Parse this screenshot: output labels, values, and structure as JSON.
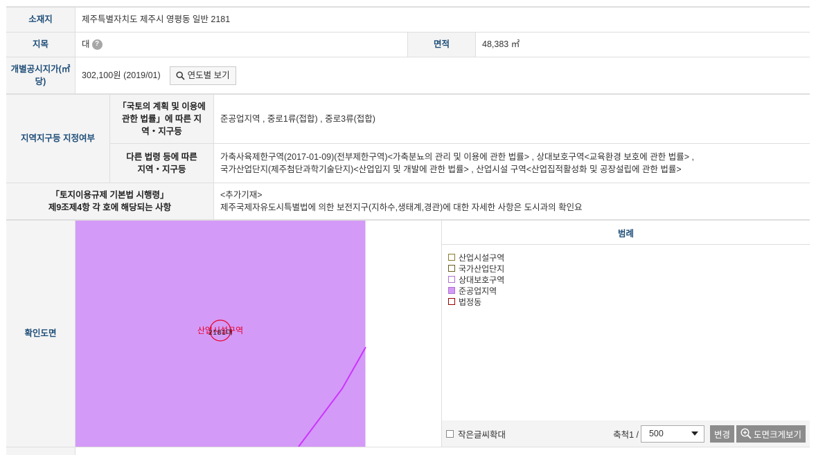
{
  "location": {
    "label": "소재지",
    "value": "제주특별자치도 제주시 영평동 일반 2181"
  },
  "land_category": {
    "label": "지목",
    "value": "대",
    "help_icon": "?"
  },
  "area": {
    "label": "면적",
    "value": "48,383 ㎡"
  },
  "official_price": {
    "label": "개별공시지가(㎡ 당)",
    "value": "302,100원 (2019/01)",
    "button_label": "연도별 보기"
  },
  "zoning": {
    "label": "지역지구등 지정여부",
    "national": {
      "label": "「국토의 계획 및 이용에 관한 법률」에 따른 지역・지구등",
      "value": "준공업지역 , 중로1류(접합) , 중로3류(접합)"
    },
    "other": {
      "label": "다른 법령 등에 따른 지역・지구등",
      "value_line1": "가축사육제한구역(2017-01-09)(전부제한구역)<가축분뇨의 관리 및 이용에 관한 법률> , 상대보호구역<교육환경 보호에 관한 법률> ,",
      "value_line2": "국가산업단지(제주첨단과학기술단지)<산업입지 및 개발에 관한 법률> , 산업시설 구역<산업집적활성화 및 공장설립에 관한 법률>"
    }
  },
  "regulation": {
    "label_line1": "「토지이용규제 기본법 시행령」",
    "label_line2": "제9조제4항 각 호에 해당되는 사항",
    "value_line1": "<추가기재>",
    "value_line2": "제주국제자유도시특별법에 의한 보전지구(지하수,생태계,경관)에 대한 자세한 사항은 도시과의 확인요"
  },
  "map": {
    "label": "확인도면",
    "zone_label": "산업시설구역",
    "parcel_label": "2181대",
    "zone_color": "#d49af7",
    "boundary_color": "#cc33ff",
    "marker_color": "#e8002a"
  },
  "legend": {
    "title": "범례",
    "items": [
      {
        "label": "산업시설구역",
        "color": "#ffffff",
        "border": "#8a7a2a"
      },
      {
        "label": "국가산업단지",
        "color": "#ffffff",
        "border": "#6a5a1a"
      },
      {
        "label": "상대보호구역",
        "color": "#ffffff",
        "border": "#b070d0"
      },
      {
        "label": "준공업지역",
        "color": "#d49af7",
        "border": "#b070d0"
      },
      {
        "label": "법정동",
        "color": "#ffffff",
        "border": "#990000"
      }
    ],
    "small_text_label": "작은글씨확대",
    "scale_label": "축척1 /",
    "scale_value": "500",
    "change_button": "변경",
    "enlarge_button": "도면크게보기"
  }
}
